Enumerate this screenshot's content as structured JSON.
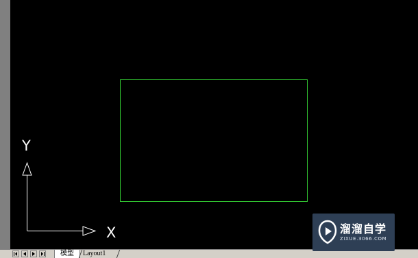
{
  "drawing": {
    "ucs": {
      "x_label": "X",
      "y_label": "Y"
    },
    "rectangle_color": "#33cc33"
  },
  "tabs": [
    {
      "label": "模型",
      "active": true
    },
    {
      "label": "Layout1",
      "active": false
    }
  ],
  "nav_icons": [
    "first-tab-icon",
    "prev-tab-icon",
    "next-tab-icon",
    "last-tab-icon"
  ],
  "watermark": {
    "title": "溜溜自学",
    "url": "ZIXUE.3066.COM"
  }
}
